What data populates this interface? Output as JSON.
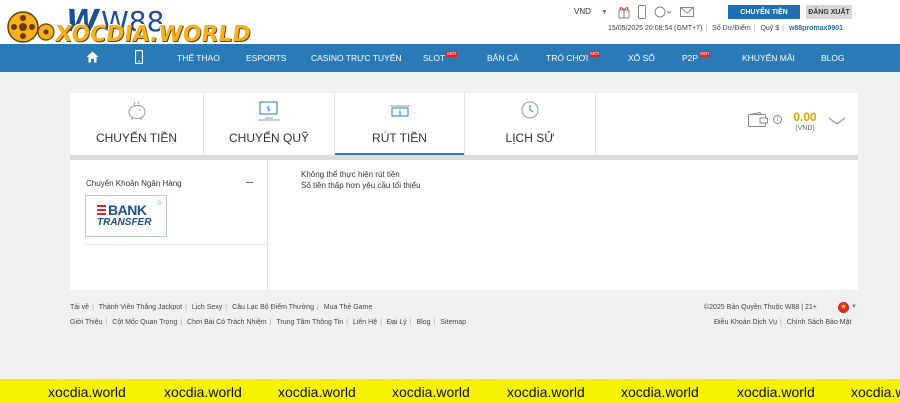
{
  "brand": {
    "w88_mark": "W",
    "w88_text": "W88",
    "xocdia_text": "XOCDIA.WORLD"
  },
  "header": {
    "language": "VND",
    "transfer_button": "CHUYỂN TIỀN",
    "logout_button": "ĐĂNG XUẤT",
    "datetime": "15/05/2025 20:08:54 (GMT+7)",
    "balance_label": "Số Dư/Điểm",
    "fund_label": "Quỹ $",
    "username": "w88promax0901"
  },
  "nav": {
    "items": [
      {
        "label": "THỂ THAO",
        "new": false
      },
      {
        "label": "ESPORTS",
        "new": false
      },
      {
        "label": "CASINO TRỰC TUYẾN",
        "new": false
      },
      {
        "label": "SLOT",
        "new": true
      },
      {
        "label": "BẮN CÁ",
        "new": false
      },
      {
        "label": "TRÒ CHƠI",
        "new": true
      },
      {
        "label": "XỔ SỐ",
        "new": false
      },
      {
        "label": "P2P",
        "new": true
      },
      {
        "label": "KHUYẾN MÃI",
        "new": false
      },
      {
        "label": "BLOG",
        "new": false
      }
    ],
    "new_badge": "MỚI"
  },
  "tabs": [
    {
      "label": "CHUYỂN TIỀN",
      "icon": "piggy-bank-icon",
      "active": false
    },
    {
      "label": "CHUYỂN QUỸ",
      "icon": "monitor-transfer-icon",
      "active": false
    },
    {
      "label": "RÚT TIỀN",
      "icon": "cash-withdraw-icon",
      "active": true
    },
    {
      "label": "LỊCH SỬ",
      "icon": "clock-history-icon",
      "active": false
    }
  ],
  "balance": {
    "amount": "0.00",
    "currency": "(VND)"
  },
  "withdraw": {
    "method_title": "Chuyển Khoản Ngân Hàng",
    "bank_word": "BANK",
    "transfer_word": "TRANSFER",
    "message_line1": "Không thể thực hiện rút tiền",
    "message_line2": "Số tiền thấp hơn yêu cầu tối thiểu"
  },
  "footer": {
    "row1": [
      "Tải về",
      "Thành Viên Thắng Jackpot",
      "Lịch Sexy",
      "Câu Lạc Bộ Điểm Thưởng",
      "Mua Thẻ Game"
    ],
    "row2": [
      "Giới Thiệu",
      "Cột Mốc Quan Trọng",
      "Chơi Bài Có Trách Nhiệm",
      "Trung Tâm Thông Tin",
      "Liên Hệ",
      "Đại Lý",
      "Blog",
      "Sitemap"
    ],
    "copyright": "©2025 Bản Quyền Thuộc W88 | 21+",
    "right_links": [
      "Điều Khoản Dịch Vụ",
      "Chính Sách Bảo Mật"
    ]
  },
  "watermark": {
    "text": "xocdia.world",
    "count": 8
  },
  "colors": {
    "nav_blue": "#2a7ab8",
    "balance_gold": "#e0a400",
    "band_yellow": "#f7f300"
  }
}
